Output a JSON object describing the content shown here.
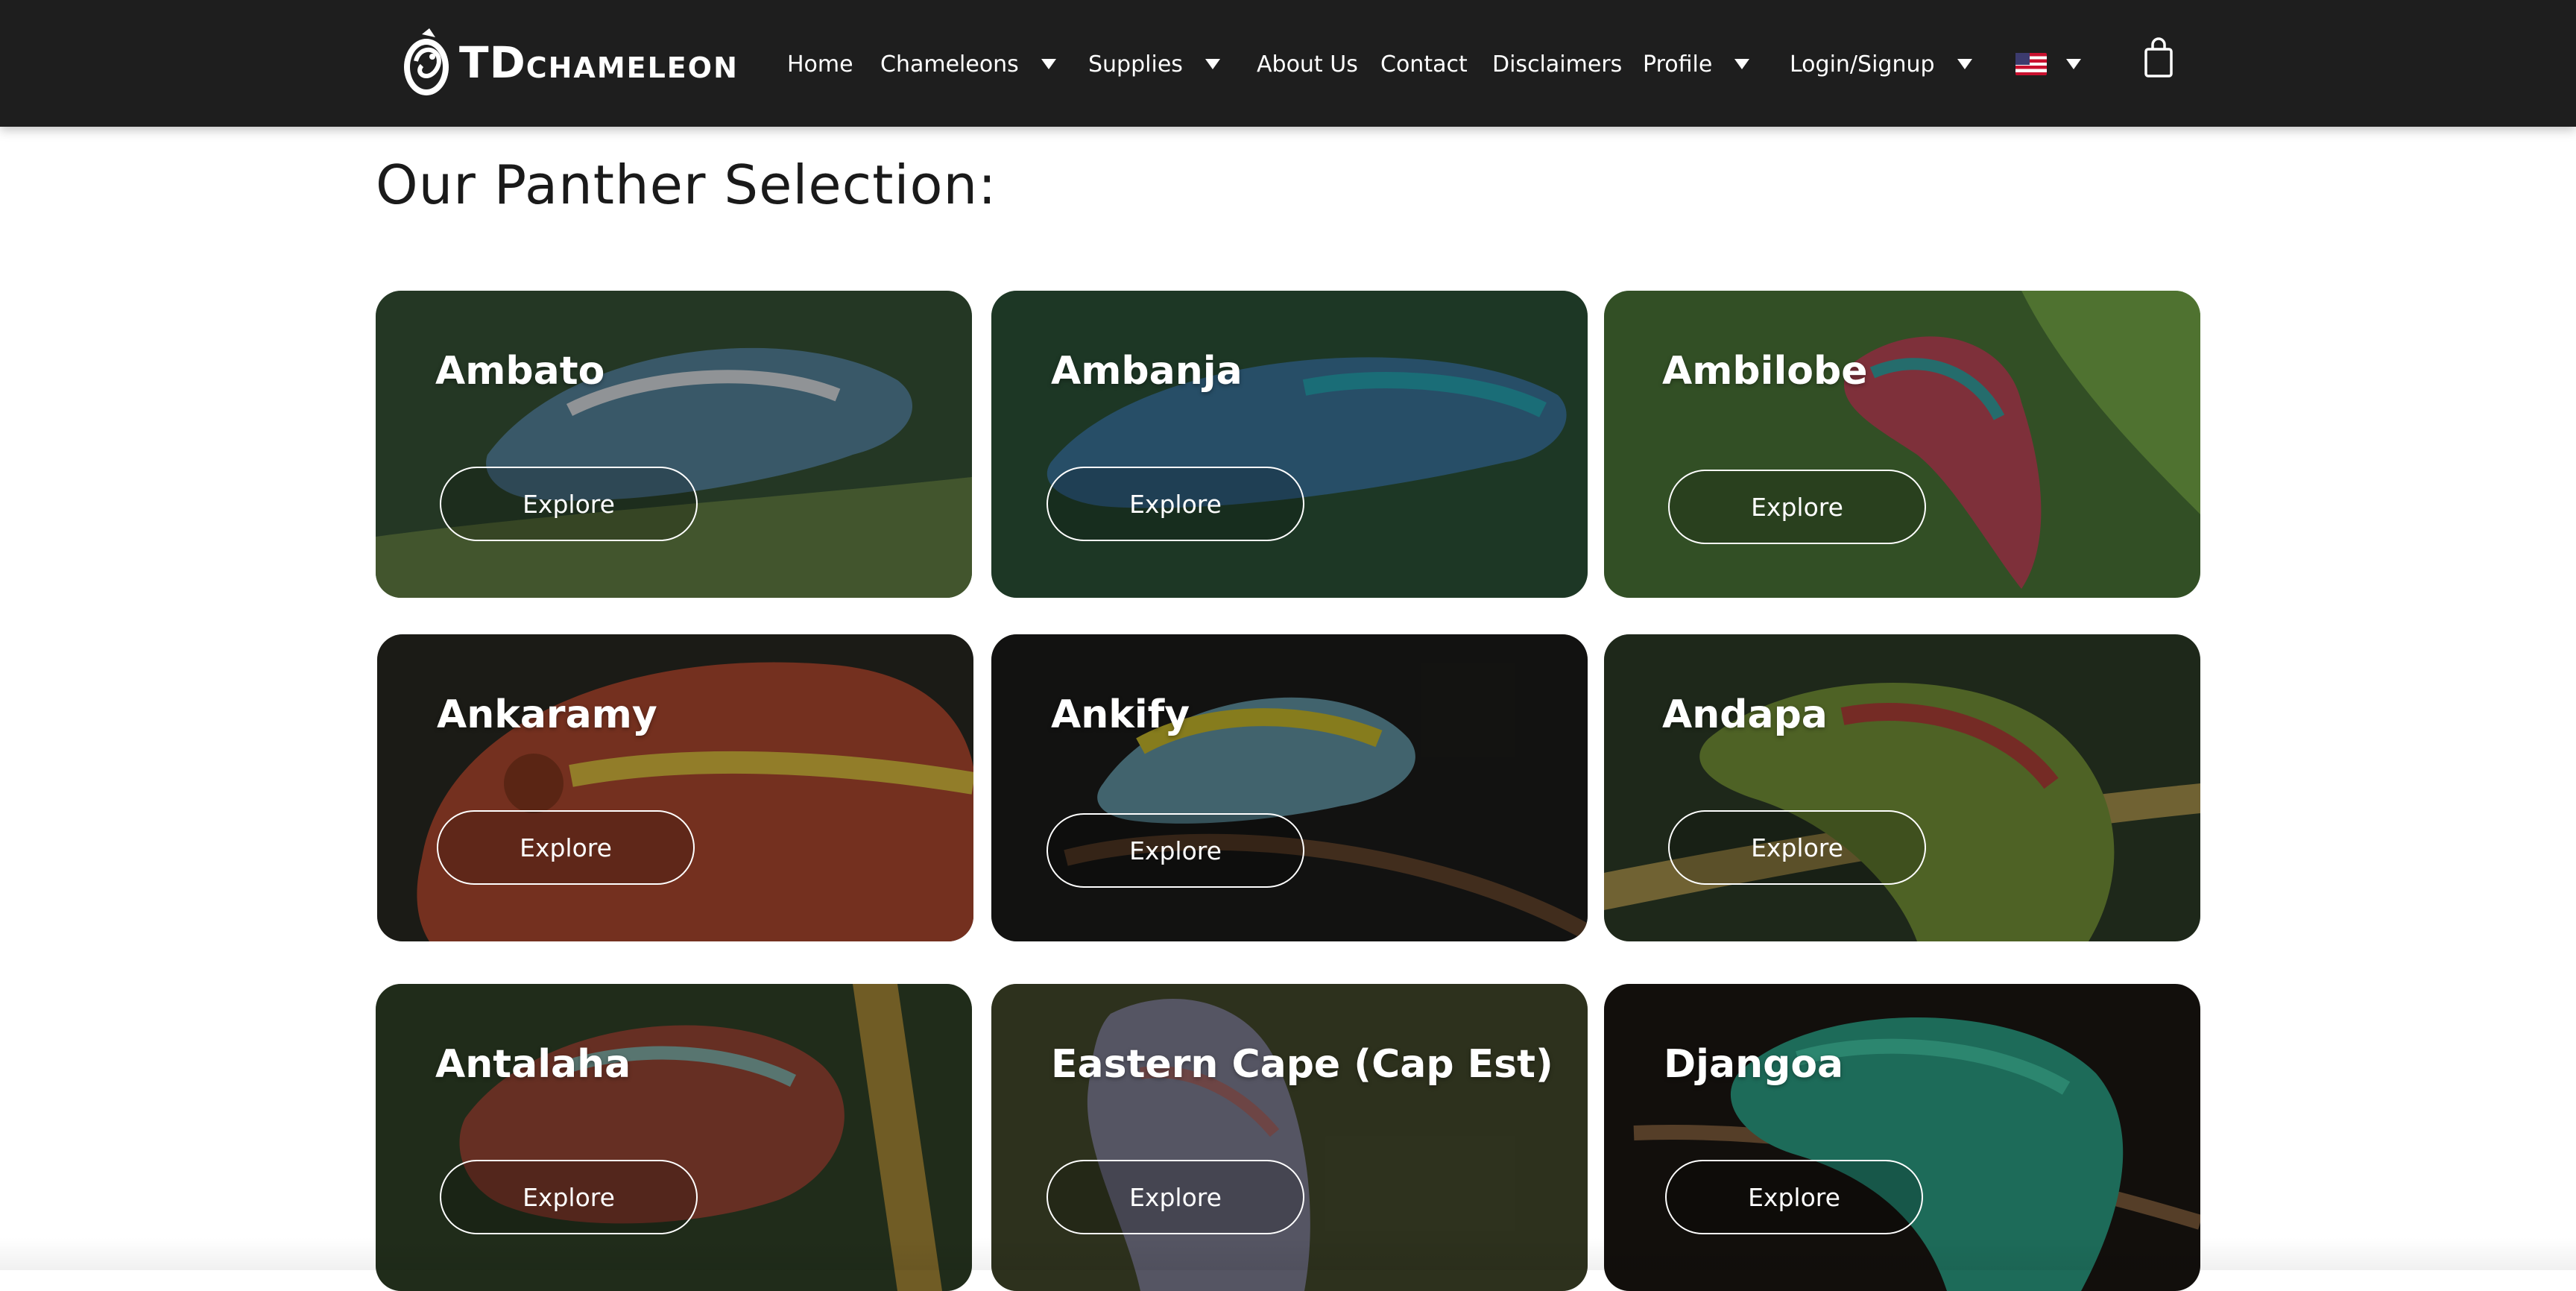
{
  "brand": {
    "logo_main": "TD",
    "logo_sub": "CHAMELEON"
  },
  "nav": {
    "home": "Home",
    "chameleons": "Chameleons",
    "supplies": "Supplies",
    "about": "About Us",
    "contact": "Contact",
    "disclaimers": "Disclaimers",
    "profile": "Profile",
    "login": "Login/Signup",
    "language_flag": "us-flag-icon",
    "cart_icon": "shopping-bag-icon"
  },
  "page": {
    "title": "Our Panther Selection:"
  },
  "cards": [
    {
      "name": "Ambato",
      "button": "Explore",
      "bg": "#3a5a3a",
      "body": "#5d8fa8",
      "accent": "#e8eef2"
    },
    {
      "name": "Ambanja",
      "button": "Explore",
      "bg": "#2f5a3d",
      "body": "#3f7fa6",
      "accent": "#2bb0c0"
    },
    {
      "name": "Ambilobe",
      "button": "Explore",
      "bg": "#4e7a3a",
      "body": "#c24a5a",
      "accent": "#3aa6a6"
    },
    {
      "name": "Ankaramy",
      "button": "Explore",
      "bg": "#2a2a22",
      "body": "#b24a30",
      "accent": "#e0c040"
    },
    {
      "name": "Ankify",
      "button": "Explore",
      "bg": "#1e1e1c",
      "body": "#6aa0b0",
      "accent": "#d8c830"
    },
    {
      "name": "Andapa",
      "button": "Explore",
      "bg": "#2f3f2a",
      "body": "#7a9a3a",
      "accent": "#b8443a"
    },
    {
      "name": "Antalaha",
      "button": "Explore",
      "bg": "#33452a",
      "body": "#a04a38",
      "accent": "#8ab8b0"
    },
    {
      "name": "Eastern Cape (Cap Est)",
      "button": "Explore",
      "bg": "#4a5030",
      "body": "#8a8aa0",
      "accent": "#b07070"
    },
    {
      "name": "Djangoa",
      "button": "Explore",
      "bg": "#1a1612",
      "body": "#2a9a80",
      "accent": "#40c0a0"
    }
  ]
}
